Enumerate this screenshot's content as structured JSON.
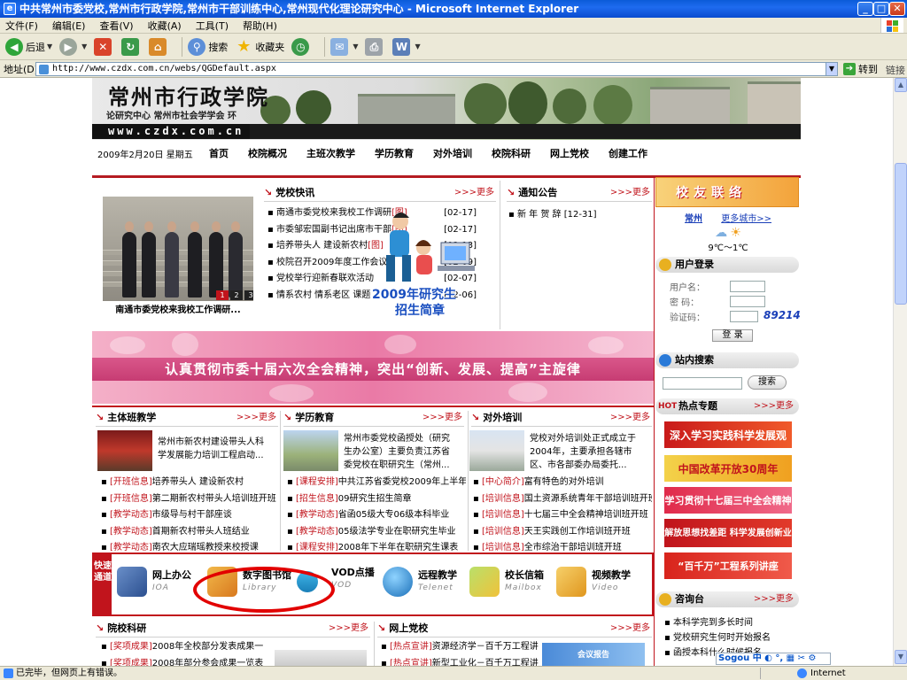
{
  "window": {
    "title": "中共常州市委党校,常州市行政学院,常州市干部训练中心,常州现代化理论研究中心 - Microsoft Internet Explorer",
    "minimize": "_",
    "maximize": "□",
    "close": "✕"
  },
  "menu": [
    "文件(F)",
    "编辑(E)",
    "查看(V)",
    "收藏(A)",
    "工具(T)",
    "帮助(H)"
  ],
  "toolbar": {
    "back": "后退",
    "search": "搜索",
    "favorites": "收藏夹"
  },
  "address": {
    "label": "地址(D)",
    "url": "http://www.czdx.com.cn/webs/QGDefault.aspx",
    "go": "转到",
    "links": "链接"
  },
  "status": {
    "text": "已完毕，但网页上有错误。",
    "zone": "Internet"
  },
  "header": {
    "school_name": "常州市行政学院",
    "subtitle": "论研究中心  常州市社会学学会  环",
    "url": "www.czdx.com.cn"
  },
  "nav": {
    "date": "2009年2月20日   星期五",
    "items": [
      "首页",
      "校院概况",
      "主班次教学",
      "学历教育",
      "对外培训",
      "校院科研",
      "网上党校",
      "创建工作"
    ]
  },
  "more_label": ">>>更多",
  "photo": {
    "caption": "南通市委党校来我校工作调研...",
    "nums": [
      "1",
      "2",
      "3"
    ]
  },
  "school_news": {
    "title": "党校快讯",
    "items": [
      {
        "text": "南通市委党校来我校工作调研",
        "tag": "[图]",
        "date": "[02-17]"
      },
      {
        "text": "市委邹宏国副书记出席市干部",
        "tag": "[图]",
        "date": "[02-17]"
      },
      {
        "text": "培养带头人 建设新农村",
        "tag": "[图]",
        "date": "[02-13]"
      },
      {
        "text": "校院召开2009年度工作会议",
        "tag": "",
        "date": "[02-09]"
      },
      {
        "text": "党校举行迎新春联欢活动",
        "tag": "",
        "date": "[02-07]"
      },
      {
        "text": "情系农村 情系老区 课题",
        "tag": "",
        "date": "[02-06]"
      }
    ]
  },
  "notice": {
    "title": "通知公告",
    "items": [
      {
        "text": "新 年 贺 辞",
        "date": "[12-31]"
      }
    ]
  },
  "ad_overlay": {
    "line1": "2009年研究生",
    "line2": "招生简章"
  },
  "slogan": "认真贯彻市委十届六次全会精神，突出“创新、发展、提高”主旋律",
  "main_class": {
    "title": "主体班教学",
    "blurb": "常州市新农村建设带头人科学发展能力培训工程启动...",
    "items": [
      {
        "tag": "[开班信息]",
        "text": "培养带头人 建设新农村"
      },
      {
        "tag": "[开班信息]",
        "text": "第二期新农村带头人培训班开班"
      },
      {
        "tag": "[教学动态]",
        "text": "市级导与村干部座谈"
      },
      {
        "tag": "[教学动态]",
        "text": "首期新农村带头人班结业"
      },
      {
        "tag": "[教学动态]",
        "text": "南农大应瑞瑶教授来校授课"
      }
    ]
  },
  "degree": {
    "title": "学历教育",
    "blurb": "常州市委党校函授处（研究生办公室）主要负责江苏省委党校在职研究生（常州...",
    "items": [
      {
        "tag": "[课程安排]",
        "text": "中共江苏省委党校2009年上半年在职"
      },
      {
        "tag": "[招生信息]",
        "text": "09研究生招生简章"
      },
      {
        "tag": "[教学动态]",
        "text": "省函05级大专06级本科毕业"
      },
      {
        "tag": "[教学动态]",
        "text": "05级法学专业在职研究生毕业"
      },
      {
        "tag": "[课程安排]",
        "text": "2008年下半年在职研究生课表"
      }
    ]
  },
  "external": {
    "title": "对外培训",
    "blurb": "党校对外培训处正式成立于2004年，主要承担各辖市区、市各部委办局委托...",
    "items": [
      {
        "tag": "[中心简介]",
        "text": "富有特色的对外培训"
      },
      {
        "tag": "[培训信息]",
        "text": "国土资源系统青年干部培训班开班"
      },
      {
        "tag": "[培训信息]",
        "text": "十七届三中全会精神培训班开班"
      },
      {
        "tag": "[培训信息]",
        "text": "天王实践创工作培训班开班"
      },
      {
        "tag": "[培训信息]",
        "text": "全市综治干部培训班开班"
      }
    ]
  },
  "quick": {
    "label": "快速通道",
    "items": [
      {
        "name": "网上办公",
        "en": "IOA"
      },
      {
        "name": "数字图书馆",
        "en": "Library"
      },
      {
        "name": "VOD点播",
        "en": "VOD"
      },
      {
        "name": "远程教学",
        "en": "Telenet"
      },
      {
        "name": "校长信箱",
        "en": "Mailbox"
      },
      {
        "name": "视频教学",
        "en": "Video"
      }
    ]
  },
  "research": {
    "title": "院校科研",
    "items": [
      {
        "tag": "[奖项成果]",
        "text": "2008年全校部分发表成果一"
      },
      {
        "tag": "[奖项成果]",
        "text": "2008年部分参会成果一览表"
      }
    ]
  },
  "online": {
    "title": "网上党校",
    "items": [
      {
        "tag": "[热点宣讲]",
        "text": "资源经济学－百千万工程讲座"
      },
      {
        "tag": "[热点宣讲]",
        "text": "新型工业化－百千万工程讲座"
      }
    ],
    "img_text": "会议报告"
  },
  "right": {
    "contact_title": "校友联络",
    "weather_city": "常州",
    "weather_more": "更多城市>>",
    "temp": "9℃～1℃",
    "login_title": "用户登录",
    "username": "用户名：",
    "password": "密  码：",
    "captcha": "验证码：",
    "captcha_value": "89214",
    "login_btn": "登 录",
    "search_title": "站内搜索",
    "search_btn": "搜索",
    "hot_title": "热点专题",
    "hot_badge": "HOT",
    "hot_items": [
      "深入学习实践科学发展观",
      "中国改革开放30周年",
      "学习贯彻十七届三中全会精神",
      "解放思想找差距 科学发展创新业",
      "“百千万”工程系列讲座"
    ],
    "consult_title": "咨询台",
    "consult_items": [
      "本科学完到多长时间",
      "党校研究生何时开始报名",
      "函授本科什么时候报名"
    ]
  },
  "sogou": "Sogou 中"
}
